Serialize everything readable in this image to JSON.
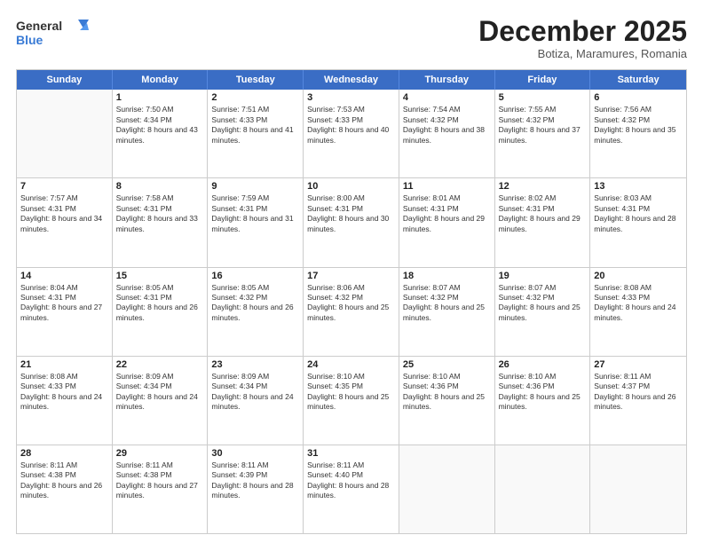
{
  "logo": {
    "general": "General",
    "blue": "Blue"
  },
  "title": "December 2025",
  "subtitle": "Botiza, Maramures, Romania",
  "headers": [
    "Sunday",
    "Monday",
    "Tuesday",
    "Wednesday",
    "Thursday",
    "Friday",
    "Saturday"
  ],
  "weeks": [
    [
      {
        "day": "",
        "sunrise": "",
        "sunset": "",
        "daylight": ""
      },
      {
        "day": "1",
        "sunrise": "Sunrise: 7:50 AM",
        "sunset": "Sunset: 4:34 PM",
        "daylight": "Daylight: 8 hours and 43 minutes."
      },
      {
        "day": "2",
        "sunrise": "Sunrise: 7:51 AM",
        "sunset": "Sunset: 4:33 PM",
        "daylight": "Daylight: 8 hours and 41 minutes."
      },
      {
        "day": "3",
        "sunrise": "Sunrise: 7:53 AM",
        "sunset": "Sunset: 4:33 PM",
        "daylight": "Daylight: 8 hours and 40 minutes."
      },
      {
        "day": "4",
        "sunrise": "Sunrise: 7:54 AM",
        "sunset": "Sunset: 4:32 PM",
        "daylight": "Daylight: 8 hours and 38 minutes."
      },
      {
        "day": "5",
        "sunrise": "Sunrise: 7:55 AM",
        "sunset": "Sunset: 4:32 PM",
        "daylight": "Daylight: 8 hours and 37 minutes."
      },
      {
        "day": "6",
        "sunrise": "Sunrise: 7:56 AM",
        "sunset": "Sunset: 4:32 PM",
        "daylight": "Daylight: 8 hours and 35 minutes."
      }
    ],
    [
      {
        "day": "7",
        "sunrise": "Sunrise: 7:57 AM",
        "sunset": "Sunset: 4:31 PM",
        "daylight": "Daylight: 8 hours and 34 minutes."
      },
      {
        "day": "8",
        "sunrise": "Sunrise: 7:58 AM",
        "sunset": "Sunset: 4:31 PM",
        "daylight": "Daylight: 8 hours and 33 minutes."
      },
      {
        "day": "9",
        "sunrise": "Sunrise: 7:59 AM",
        "sunset": "Sunset: 4:31 PM",
        "daylight": "Daylight: 8 hours and 31 minutes."
      },
      {
        "day": "10",
        "sunrise": "Sunrise: 8:00 AM",
        "sunset": "Sunset: 4:31 PM",
        "daylight": "Daylight: 8 hours and 30 minutes."
      },
      {
        "day": "11",
        "sunrise": "Sunrise: 8:01 AM",
        "sunset": "Sunset: 4:31 PM",
        "daylight": "Daylight: 8 hours and 29 minutes."
      },
      {
        "day": "12",
        "sunrise": "Sunrise: 8:02 AM",
        "sunset": "Sunset: 4:31 PM",
        "daylight": "Daylight: 8 hours and 29 minutes."
      },
      {
        "day": "13",
        "sunrise": "Sunrise: 8:03 AM",
        "sunset": "Sunset: 4:31 PM",
        "daylight": "Daylight: 8 hours and 28 minutes."
      }
    ],
    [
      {
        "day": "14",
        "sunrise": "Sunrise: 8:04 AM",
        "sunset": "Sunset: 4:31 PM",
        "daylight": "Daylight: 8 hours and 27 minutes."
      },
      {
        "day": "15",
        "sunrise": "Sunrise: 8:05 AM",
        "sunset": "Sunset: 4:31 PM",
        "daylight": "Daylight: 8 hours and 26 minutes."
      },
      {
        "day": "16",
        "sunrise": "Sunrise: 8:05 AM",
        "sunset": "Sunset: 4:32 PM",
        "daylight": "Daylight: 8 hours and 26 minutes."
      },
      {
        "day": "17",
        "sunrise": "Sunrise: 8:06 AM",
        "sunset": "Sunset: 4:32 PM",
        "daylight": "Daylight: 8 hours and 25 minutes."
      },
      {
        "day": "18",
        "sunrise": "Sunrise: 8:07 AM",
        "sunset": "Sunset: 4:32 PM",
        "daylight": "Daylight: 8 hours and 25 minutes."
      },
      {
        "day": "19",
        "sunrise": "Sunrise: 8:07 AM",
        "sunset": "Sunset: 4:32 PM",
        "daylight": "Daylight: 8 hours and 25 minutes."
      },
      {
        "day": "20",
        "sunrise": "Sunrise: 8:08 AM",
        "sunset": "Sunset: 4:33 PM",
        "daylight": "Daylight: 8 hours and 24 minutes."
      }
    ],
    [
      {
        "day": "21",
        "sunrise": "Sunrise: 8:08 AM",
        "sunset": "Sunset: 4:33 PM",
        "daylight": "Daylight: 8 hours and 24 minutes."
      },
      {
        "day": "22",
        "sunrise": "Sunrise: 8:09 AM",
        "sunset": "Sunset: 4:34 PM",
        "daylight": "Daylight: 8 hours and 24 minutes."
      },
      {
        "day": "23",
        "sunrise": "Sunrise: 8:09 AM",
        "sunset": "Sunset: 4:34 PM",
        "daylight": "Daylight: 8 hours and 24 minutes."
      },
      {
        "day": "24",
        "sunrise": "Sunrise: 8:10 AM",
        "sunset": "Sunset: 4:35 PM",
        "daylight": "Daylight: 8 hours and 25 minutes."
      },
      {
        "day": "25",
        "sunrise": "Sunrise: 8:10 AM",
        "sunset": "Sunset: 4:36 PM",
        "daylight": "Daylight: 8 hours and 25 minutes."
      },
      {
        "day": "26",
        "sunrise": "Sunrise: 8:10 AM",
        "sunset": "Sunset: 4:36 PM",
        "daylight": "Daylight: 8 hours and 25 minutes."
      },
      {
        "day": "27",
        "sunrise": "Sunrise: 8:11 AM",
        "sunset": "Sunset: 4:37 PM",
        "daylight": "Daylight: 8 hours and 26 minutes."
      }
    ],
    [
      {
        "day": "28",
        "sunrise": "Sunrise: 8:11 AM",
        "sunset": "Sunset: 4:38 PM",
        "daylight": "Daylight: 8 hours and 26 minutes."
      },
      {
        "day": "29",
        "sunrise": "Sunrise: 8:11 AM",
        "sunset": "Sunset: 4:38 PM",
        "daylight": "Daylight: 8 hours and 27 minutes."
      },
      {
        "day": "30",
        "sunrise": "Sunrise: 8:11 AM",
        "sunset": "Sunset: 4:39 PM",
        "daylight": "Daylight: 8 hours and 28 minutes."
      },
      {
        "day": "31",
        "sunrise": "Sunrise: 8:11 AM",
        "sunset": "Sunset: 4:40 PM",
        "daylight": "Daylight: 8 hours and 28 minutes."
      },
      {
        "day": "",
        "sunrise": "",
        "sunset": "",
        "daylight": ""
      },
      {
        "day": "",
        "sunrise": "",
        "sunset": "",
        "daylight": ""
      },
      {
        "day": "",
        "sunrise": "",
        "sunset": "",
        "daylight": ""
      }
    ]
  ]
}
